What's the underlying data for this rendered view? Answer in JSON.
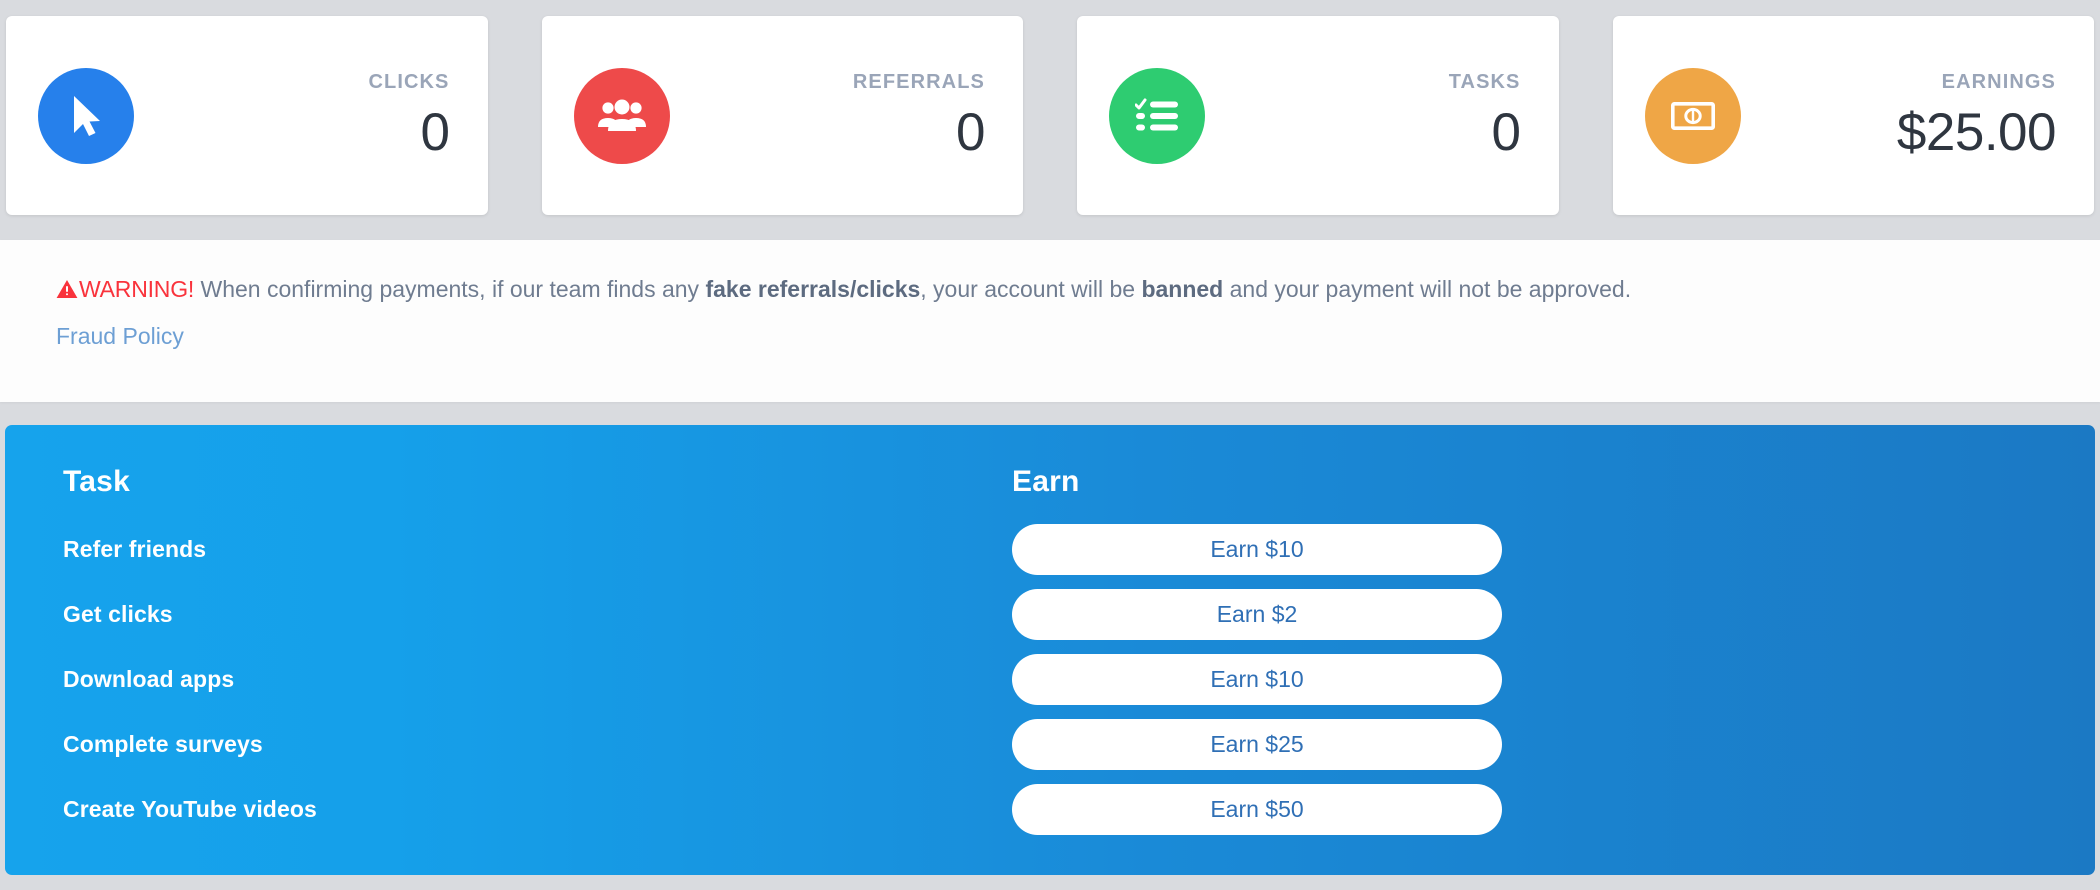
{
  "stats": {
    "cards": [
      {
        "label": "CLICKS",
        "value": "0",
        "icon": "cursor-pointer-icon",
        "color": "#2680eb"
      },
      {
        "label": "REFERRALS",
        "value": "0",
        "icon": "users-group-icon",
        "color": "#ed4murky"
      },
      {
        "label": "TASKS",
        "value": "0",
        "icon": "task-checklist-icon",
        "color": "#2ecc71"
      },
      {
        "label": "EARNINGS",
        "value": "$25.00",
        "icon": "money-bill-icon",
        "color": "#efa646"
      }
    ]
  },
  "warning": {
    "icon": "warning-triangle-icon",
    "keyword": "WARNING!",
    "text_part1": " When confirming payments, if our team finds any ",
    "bold1": "fake referrals/clicks",
    "text_part2": ", your account will be ",
    "bold2": "banned",
    "text_part3": " and your payment will not be approved.",
    "link_label": "Fraud Policy"
  },
  "tasks": {
    "col_task_header": "Task",
    "col_earn_header": "Earn",
    "rows": [
      {
        "task": "Refer friends",
        "earn_label": "Earn $10"
      },
      {
        "task": "Get clicks",
        "earn_label": "Earn $2"
      },
      {
        "task": "Download apps",
        "earn_label": "Earn $10"
      },
      {
        "task": "Complete surveys",
        "earn_label": "Earn $25"
      },
      {
        "task": "Create YouTube videos",
        "earn_label": "Earn $50"
      }
    ]
  },
  "colors": {
    "clicks_blue": "#2680eb",
    "referrals_red": "#ee4a4a",
    "tasks_green": "#2ecc71",
    "earnings_orange": "#efa646",
    "panel_blue_start": "#16a3ec",
    "panel_blue_end": "#1b79c4",
    "warning_red": "#f9333c",
    "link_blue": "#6d9fd4",
    "page_bg": "#d9dbdf"
  }
}
